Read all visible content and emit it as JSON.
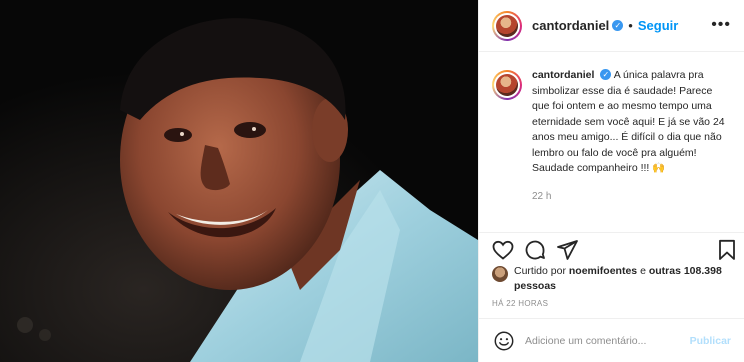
{
  "post": {
    "photo_alt": "foto do post"
  },
  "header": {
    "username": "cantordaniel",
    "follow_label": "Seguir",
    "more_label": "•••"
  },
  "caption": {
    "username": "cantordaniel",
    "text": "A única palavra pra simbolizar esse dia é saudade! Parece que foi ontem e ao mesmo tempo uma eternidade sem você aqui! E já se vão 24 anos meu amigo... É difícil o dia que não lembro ou falo de você pra alguém! Saudade companheiro !!! 🙌",
    "time": "22 h"
  },
  "likes": {
    "prefix": "Curtido por",
    "user": "noemifoentes",
    "middle": "e",
    "others": "outras 108.398 pessoas"
  },
  "post_age": "HÁ 22 HORAS",
  "comment": {
    "placeholder": "Adicione um comentário...",
    "publish_label": "Publicar"
  },
  "colors": {
    "accent": "#0095f6",
    "verified": "#3897f0",
    "publish_disabled": "#b2dffc",
    "muted": "#8e8e8e"
  },
  "icons": [
    "heart-icon",
    "comment-icon",
    "share-icon",
    "bookmark-icon",
    "emoji-icon",
    "verified-icon",
    "more-icon"
  ]
}
